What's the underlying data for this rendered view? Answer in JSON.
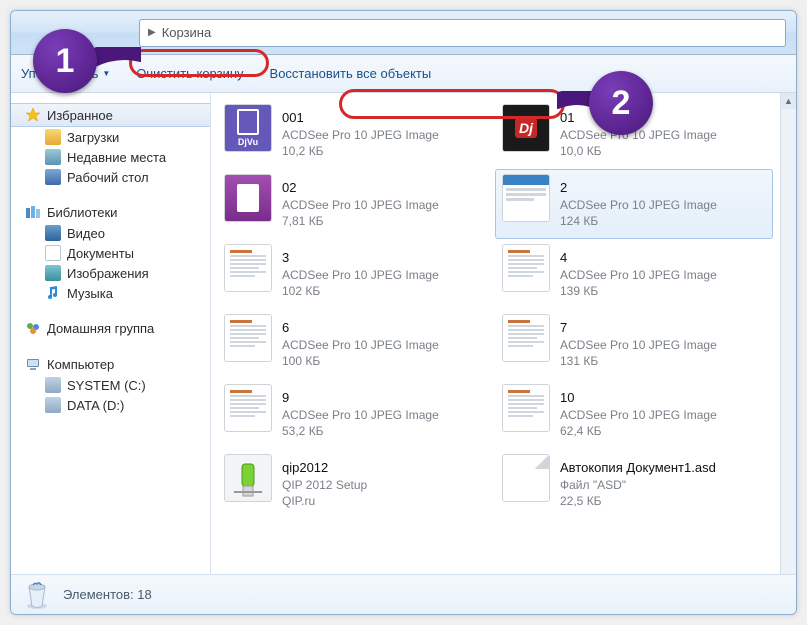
{
  "address": {
    "location": "Корзина"
  },
  "toolbar": {
    "organize": "Упорядочить",
    "empty": "Очистить корзину",
    "restore_all": "Восстановить все объекты"
  },
  "sidebar": {
    "favorites": {
      "title": "Избранное",
      "items": [
        {
          "label": "Загрузки",
          "color": "#f6c453"
        },
        {
          "label": "Недавние места",
          "color": "#6fa8c9"
        },
        {
          "label": "Рабочий стол",
          "color": "#4e7ec0"
        }
      ]
    },
    "libraries": {
      "title": "Библиотеки",
      "items": [
        {
          "label": "Видео",
          "color": "#3a6fa8"
        },
        {
          "label": "Документы",
          "color": "#cfcfcf"
        },
        {
          "label": "Изображения",
          "color": "#58a6b8"
        },
        {
          "label": "Музыка",
          "color": "#2e8bd6"
        }
      ]
    },
    "homegroup": {
      "title": "Домашняя группа"
    },
    "computer": {
      "title": "Компьютер",
      "items": [
        {
          "label": "SYSTEM (C:)",
          "color": "#8ea9c6"
        },
        {
          "label": "DATA (D:)",
          "color": "#8ea9c6"
        }
      ]
    }
  },
  "files": [
    {
      "name": "001",
      "type": "ACDSee Pro 10 JPEG Image",
      "size": "10,2 КБ",
      "thumb": "djvu"
    },
    {
      "name": "01",
      "type": "ACDSee Pro 10 JPEG Image",
      "size": "10,0 КБ",
      "thumb": "dj-red"
    },
    {
      "name": "02",
      "type": "ACDSee Pro 10 JPEG Image",
      "size": "7,81 КБ",
      "thumb": "purple"
    },
    {
      "name": "2",
      "type": "ACDSee Pro 10 JPEG Image",
      "size": "124 КБ",
      "thumb": "webpage",
      "selected": true
    },
    {
      "name": "3",
      "type": "ACDSee Pro 10 JPEG Image",
      "size": "102 КБ",
      "thumb": "doc"
    },
    {
      "name": "4",
      "type": "ACDSee Pro 10 JPEG Image",
      "size": "139 КБ",
      "thumb": "doc2"
    },
    {
      "name": "6",
      "type": "ACDSee Pro 10 JPEG Image",
      "size": "100 КБ",
      "thumb": "doc"
    },
    {
      "name": "7",
      "type": "ACDSee Pro 10 JPEG Image",
      "size": "131 КБ",
      "thumb": "doc"
    },
    {
      "name": "9",
      "type": "ACDSee Pro 10 JPEG Image",
      "size": "53,2 КБ",
      "thumb": "doc"
    },
    {
      "name": "10",
      "type": "ACDSee Pro 10 JPEG Image",
      "size": "62,4 КБ",
      "thumb": "doc"
    },
    {
      "name": "qip2012",
      "type": "QIP 2012 Setup",
      "size": "QIP.ru",
      "thumb": "qip"
    },
    {
      "name": "Автокопия Документ1.asd",
      "type": "Файл \"ASD\"",
      "size": "22,5 КБ",
      "thumb": "blank"
    }
  ],
  "status": {
    "count_label": "Элементов: 18"
  },
  "callouts": {
    "one": "1",
    "two": "2"
  }
}
